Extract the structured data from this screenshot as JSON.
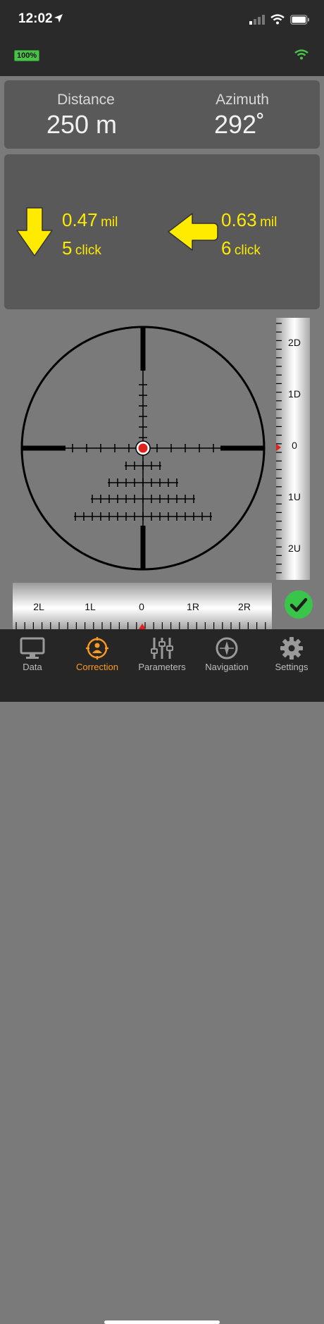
{
  "status": {
    "time": "12:02",
    "battery_badge": "100%"
  },
  "distance": {
    "label": "Distance",
    "value": "250 m"
  },
  "azimuth": {
    "label": "Azimuth",
    "value": "292˚"
  },
  "vertical": {
    "direction": "down",
    "mil": "0.47",
    "mil_unit": "mil",
    "clicks": "5",
    "click_unit": "click"
  },
  "horizontal": {
    "direction": "left",
    "mil": "0.63",
    "mil_unit": "mil",
    "clicks": "6",
    "click_unit": "click"
  },
  "v_ruler": {
    "labels": [
      "2D",
      "1D",
      "0",
      "1U",
      "2U"
    ]
  },
  "h_ruler": {
    "labels": [
      "2L",
      "1L",
      "0",
      "1R",
      "2R"
    ]
  },
  "tabs": [
    {
      "label": "Data",
      "icon": "monitor-icon",
      "active": false
    },
    {
      "label": "Correction",
      "icon": "crosshair-person-icon",
      "active": true
    },
    {
      "label": "Parameters",
      "icon": "sliders-icon",
      "active": false
    },
    {
      "label": "Navigation",
      "icon": "compass-icon",
      "active": false
    },
    {
      "label": "Settings",
      "icon": "gear-icon",
      "active": false
    }
  ],
  "colors": {
    "accent": "#ff9a1f",
    "correction": "#ffeb00",
    "ok": "#39c44a",
    "marker": "#e0221b",
    "battery": "#4ac24a"
  }
}
